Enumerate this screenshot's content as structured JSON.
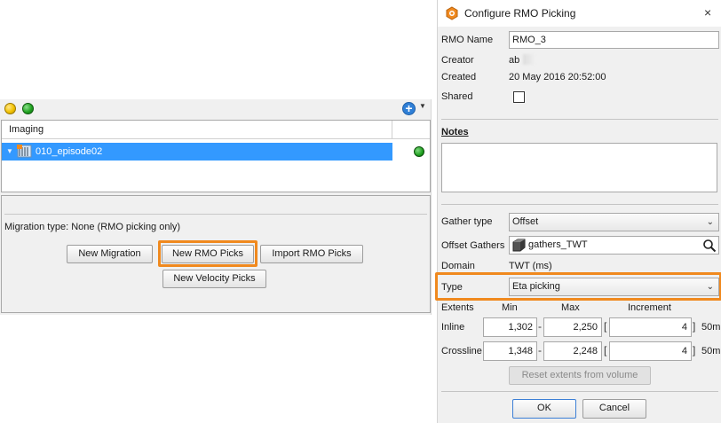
{
  "left": {
    "tree_header": "Imaging",
    "tree_item": "010_episode02",
    "migration_type": "Migration type: None (RMO picking only)",
    "buttons": {
      "new_migration": "New Migration",
      "new_rmo_picks": "New RMO Picks",
      "import_rmo_picks": "Import RMO Picks",
      "new_velocity_picks": "New Velocity Picks"
    }
  },
  "dialog": {
    "title": "Configure RMO Picking",
    "close": "×",
    "rmo_name_label": "RMO Name",
    "rmo_name_value": "RMO_3",
    "creator_label": "Creator",
    "creator_value": "ab",
    "created_label": "Created",
    "created_value": "20 May 2016 20:52:00",
    "shared_label": "Shared",
    "shared_checked": false,
    "notes_label": "Notes",
    "gather_type_label": "Gather type",
    "gather_type_value": "Offset",
    "offset_gathers_label": "Offset Gathers",
    "offset_gathers_value": "gathers_TWT",
    "domain_label": "Domain",
    "domain_value": "TWT (ms)",
    "type_label": "Type",
    "type_value": "Eta picking",
    "extents": {
      "label": "Extents",
      "min_label": "Min",
      "max_label": "Max",
      "increment_label": "Increment",
      "inline": {
        "label": "Inline",
        "min": "1,302",
        "max": "2,250",
        "increment": "4",
        "unit": "50m"
      },
      "crossline": {
        "label": "Crossline",
        "min": "1,348",
        "max": "2,248",
        "increment": "4",
        "unit": "50m"
      }
    },
    "dash": "-",
    "bracket_open": "[",
    "bracket_close": "]",
    "reset_button": "Reset extents from volume",
    "ok_button": "OK",
    "cancel_button": "Cancel"
  },
  "colors": {
    "highlight": "#f0891e",
    "selection": "#3399ff",
    "status_green": "#1fa01f"
  }
}
